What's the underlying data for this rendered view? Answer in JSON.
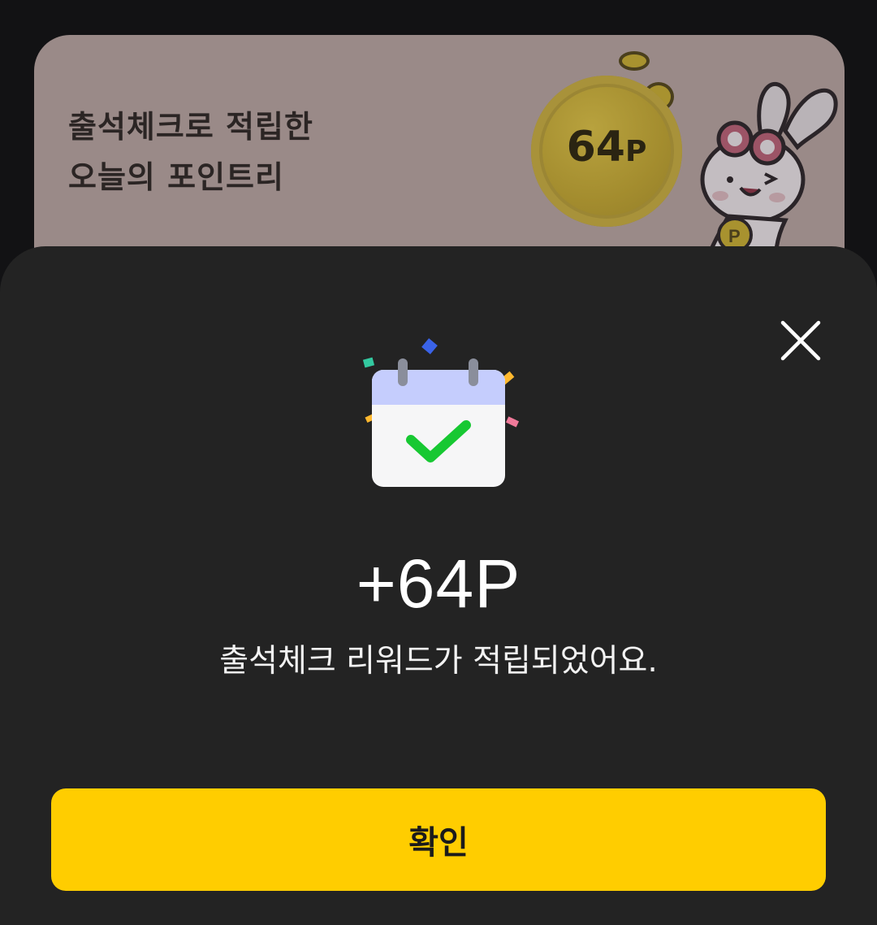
{
  "banner": {
    "title_line1": "출석체크로 적립한",
    "title_line2": "오늘의 포인트리",
    "coin_value": "64",
    "coin_unit": "P",
    "colors": {
      "background": "#9a8a88",
      "coin": "#a38c2e"
    }
  },
  "sheet": {
    "points_text": "+64P",
    "message": "출석체크 리워드가 적립되었어요.",
    "confirm_label": "확인",
    "close_icon": "close-icon",
    "calendar_icon": "calendar-check-icon",
    "colors": {
      "background": "#232323",
      "button": "#ffcd00",
      "check": "#17c832",
      "calendar_header": "#c5cdfd"
    }
  }
}
